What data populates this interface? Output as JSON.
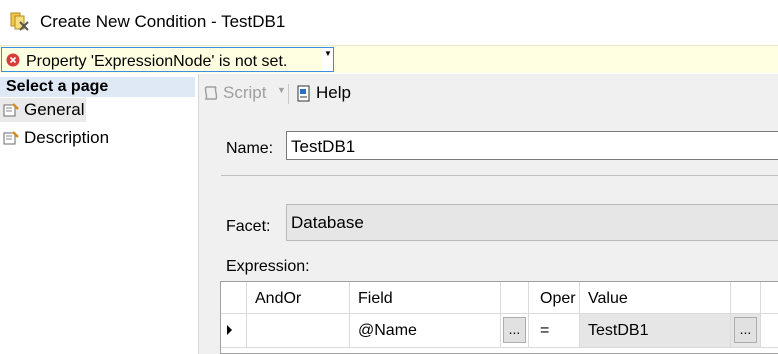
{
  "window": {
    "title": "Create New Condition - TestDB1"
  },
  "banner": {
    "message": "Property 'ExpressionNode' is not set."
  },
  "left_pane": {
    "header": "Select a page",
    "pages": [
      {
        "label": "General"
      },
      {
        "label": "Description"
      }
    ]
  },
  "toolbar": {
    "script_label": "Script",
    "help_label": "Help"
  },
  "form": {
    "name_label": "Name:",
    "name_value": "TestDB1",
    "facet_label": "Facet:",
    "facet_value": "Database",
    "expression_label": "Expression:"
  },
  "grid": {
    "columns": [
      "AndOr",
      "Field",
      "Oper",
      "Value"
    ],
    "rows": [
      {
        "andor": "",
        "field": "@Name",
        "field_button": "...",
        "oper": "=",
        "value": "TestDB1",
        "value_button": "..."
      }
    ]
  },
  "colors": {
    "banner_bg": "#ffffe1",
    "selection_border": "#3b8ee5",
    "header_bg": "#dfe9f5",
    "error_red": "#d83b3b"
  }
}
